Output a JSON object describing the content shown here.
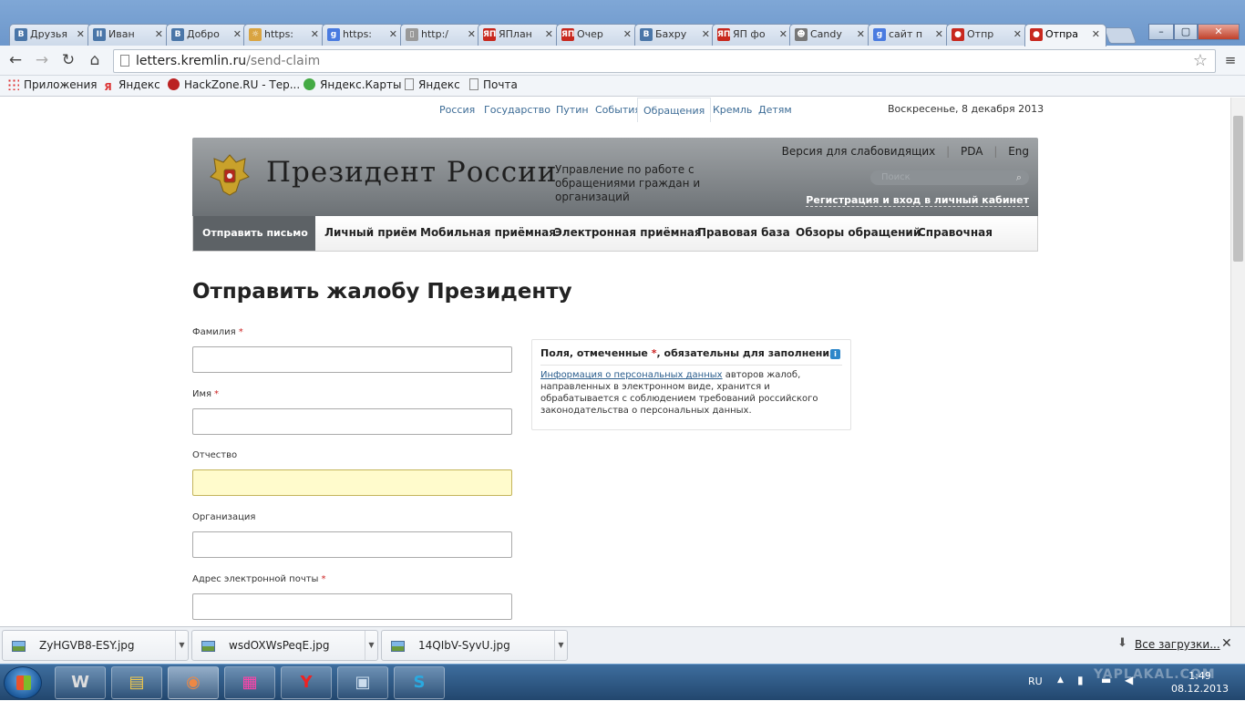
{
  "browser": {
    "tabs": [
      {
        "label": "Друзья",
        "favicon": "В",
        "color": "#4a76a8"
      },
      {
        "label": "Иван",
        "favicon": "II",
        "color": "#4a76a8"
      },
      {
        "label": "Добро",
        "favicon": "В",
        "color": "#4a76a8"
      },
      {
        "label": "https:",
        "favicon": "☼",
        "color": "#d9a441"
      },
      {
        "label": "https:",
        "favicon": "g",
        "color": "#4a7be0"
      },
      {
        "label": "http:/",
        "favicon": "▯",
        "color": "#999999"
      },
      {
        "label": "ЯПлан",
        "favicon": "ЯП",
        "color": "#c8281e"
      },
      {
        "label": "Очер",
        "favicon": "ЯП",
        "color": "#c8281e"
      },
      {
        "label": "Бахру",
        "favicon": "В",
        "color": "#4a76a8"
      },
      {
        "label": "ЯП фо",
        "favicon": "ЯП",
        "color": "#c8281e"
      },
      {
        "label": "Candy",
        "favicon": "☻",
        "color": "#777777"
      },
      {
        "label": "сайт п",
        "favicon": "g",
        "color": "#4a7be0"
      },
      {
        "label": "Отпр",
        "favicon": "●",
        "color": "#c8281e"
      },
      {
        "label": "Отпра",
        "favicon": "●",
        "color": "#c8281e",
        "active": true
      }
    ],
    "url_host": "letters.kremlin.ru",
    "url_path": "/send-claim",
    "bookmarks": [
      "Приложения",
      "Яндекс",
      "HackZone.RU - Тер...",
      "Яндекс.Карты",
      "Яндекс",
      "Почта"
    ]
  },
  "site": {
    "topnav": [
      "Россия",
      "Государство",
      "Путин",
      "События",
      "Обращения",
      "Кремль",
      "Детям"
    ],
    "topnav_active": "Обращения",
    "date": "Воскресенье, 8 декабря 2013",
    "title": "Президент России",
    "subtitle": "Управление по работе с обращениями граждан и организаций",
    "header_links": [
      "Версия для слабовидящих",
      "PDA",
      "Eng"
    ],
    "search_placeholder": "Поиск",
    "register_link": "Регистрация и вход в личный кабинет",
    "menu": [
      "Отправить письмо",
      "Личный приём",
      "Мобильная приёмная",
      "Электронная приёмная",
      "Правовая база",
      "Обзоры обращений",
      "Справочная"
    ]
  },
  "form": {
    "heading": "Отправить жалобу Президенту",
    "fields": [
      {
        "label": "Фамилия",
        "required": true,
        "value": ""
      },
      {
        "label": "Имя",
        "required": true,
        "value": ""
      },
      {
        "label": "Отчество",
        "required": false,
        "value": "",
        "focused": true
      },
      {
        "label": "Организация",
        "required": false,
        "value": ""
      },
      {
        "label": "Адрес электронной почты",
        "required": true,
        "value": ""
      }
    ],
    "required_mark": "*",
    "info_title_before": "Поля, отмеченные",
    "info_title_after": ", обязательны для заполнения",
    "info_link": "Информация о персональных данных",
    "info_text": " авторов жалоб, направленных в электронном виде, хранится и обрабатывается с соблюдением требований российского законодательства о персональных данных."
  },
  "downloads": {
    "files": [
      "ZyHGVB8-ESY.jpg",
      "wsdOXWsPeqE.jpg",
      "14QIbV-SyvU.jpg"
    ],
    "all_label": "Все загрузки..."
  },
  "taskbar": {
    "lang": "RU",
    "time": "1:49",
    "date": "08.12.2013",
    "watermark": "YAPLAKAL.COM"
  }
}
